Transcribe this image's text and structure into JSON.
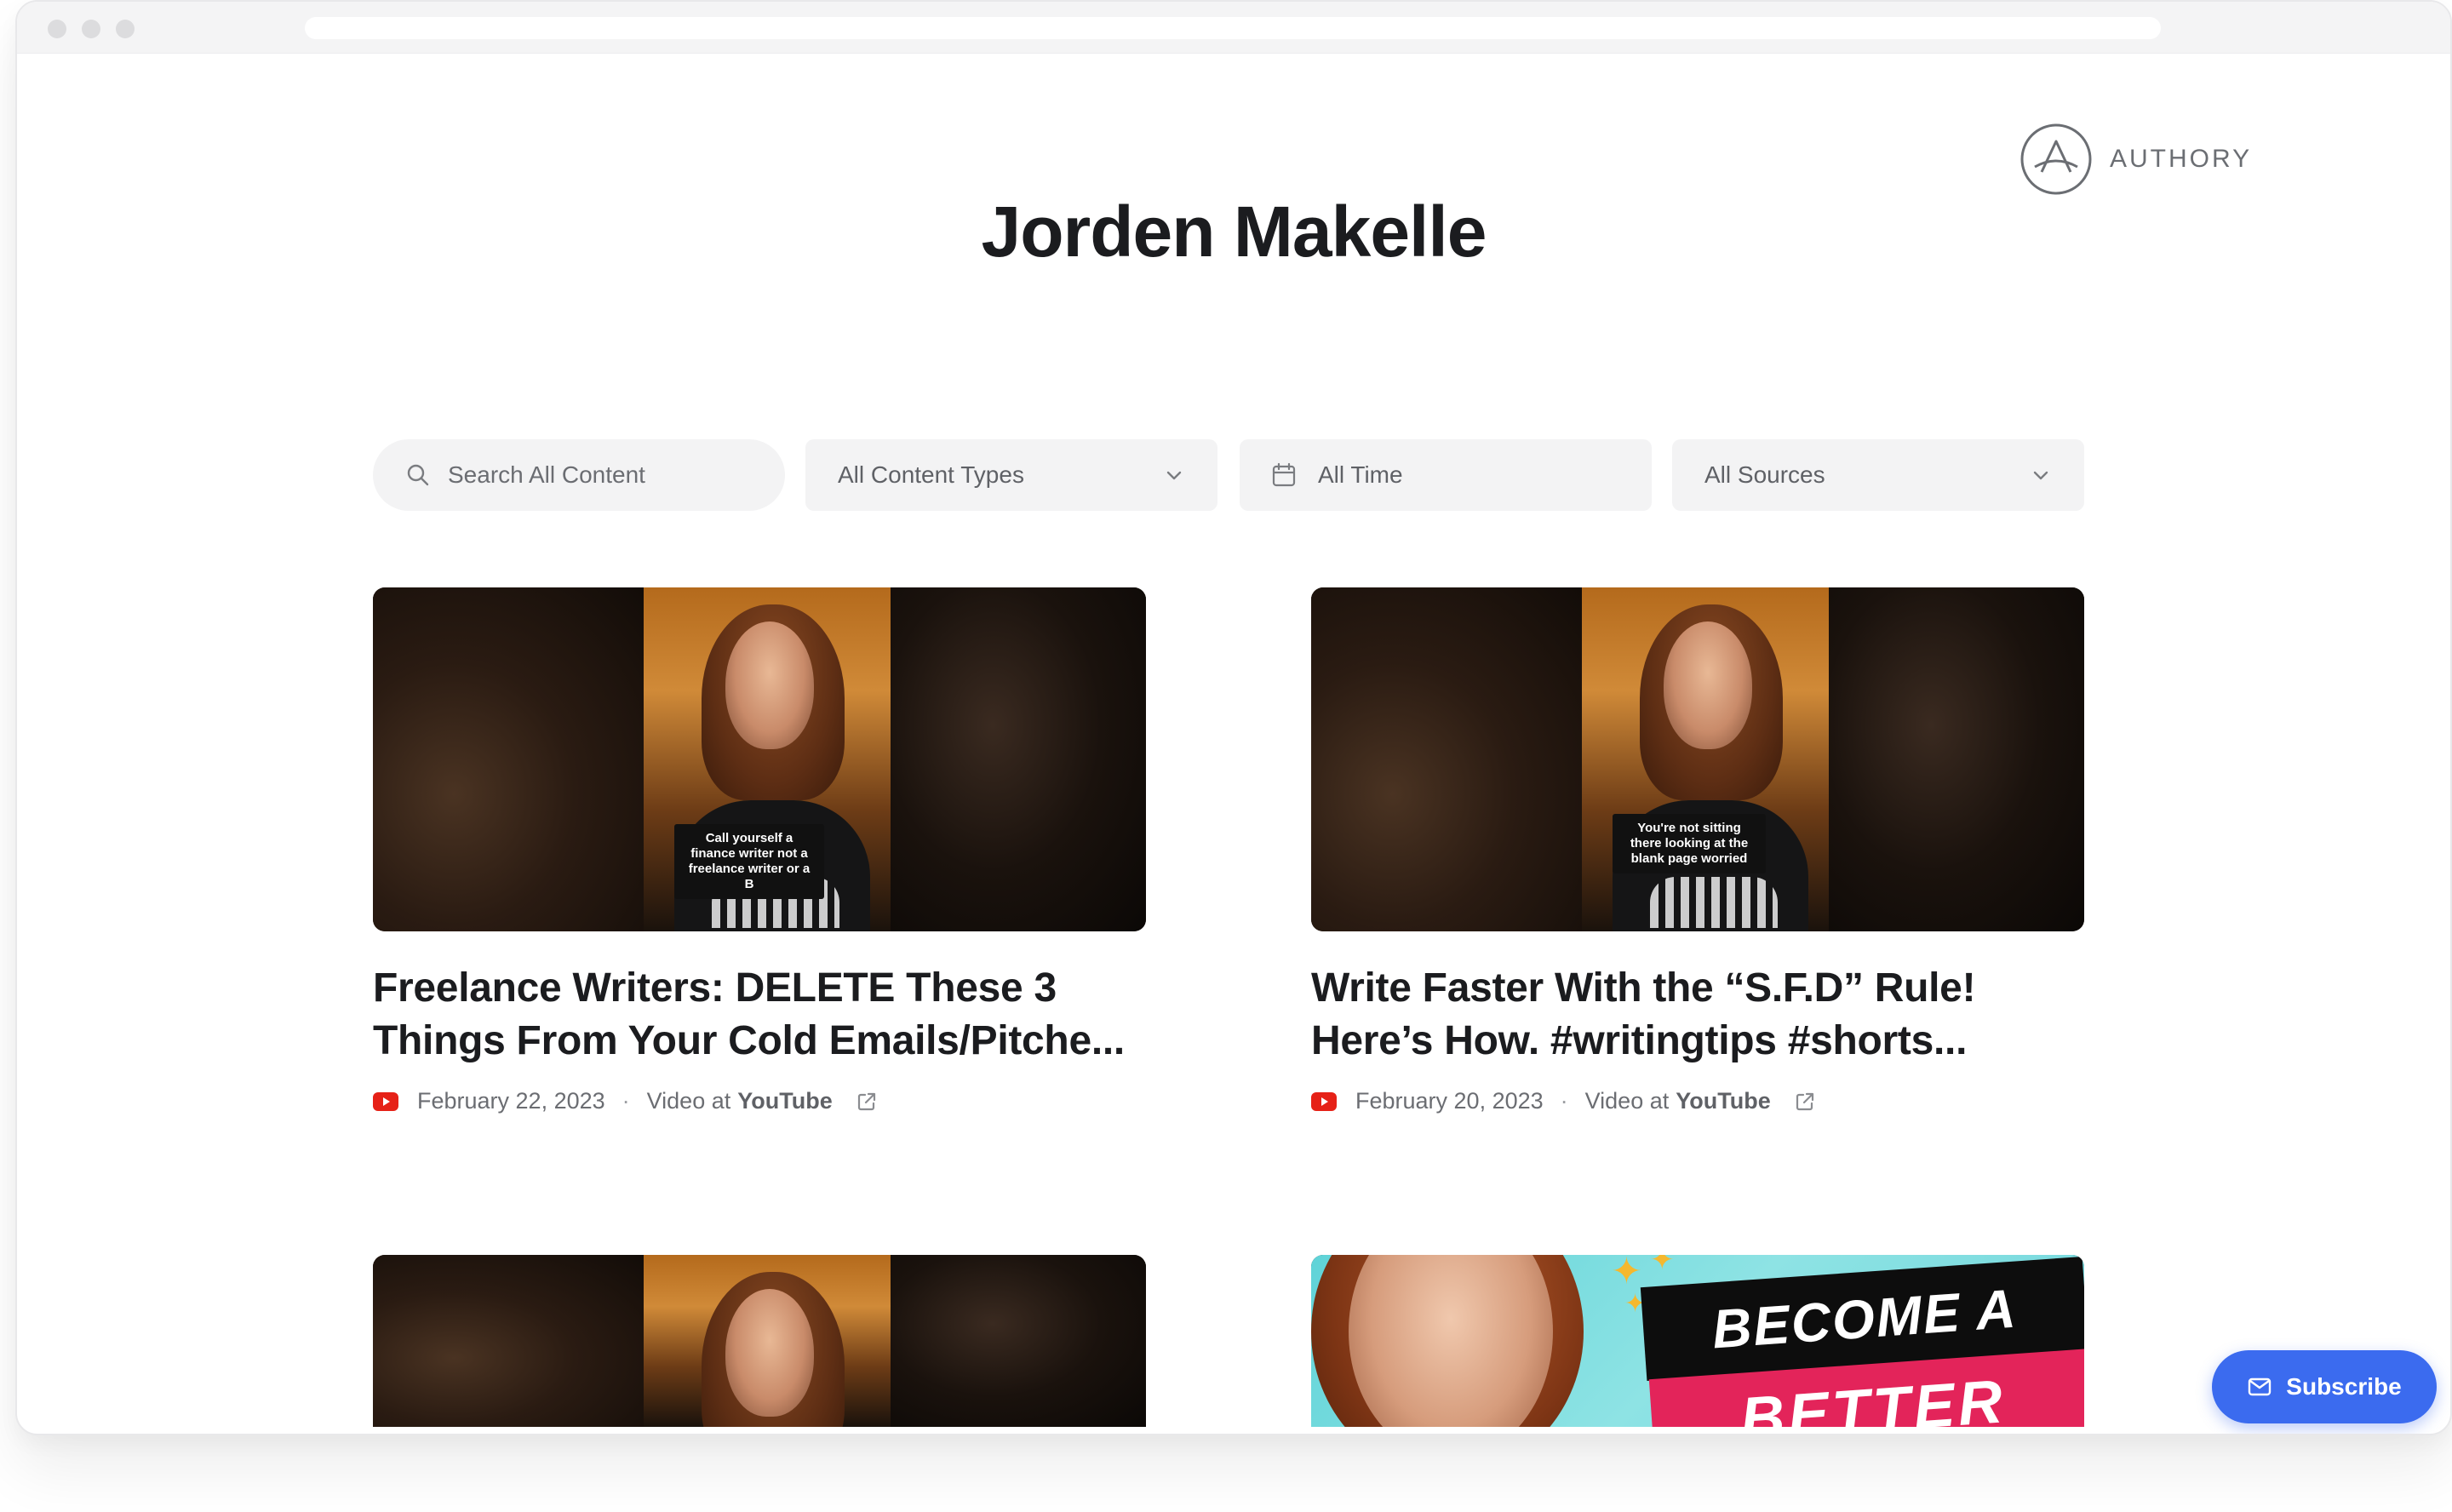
{
  "brand": {
    "name": "AUTHORY",
    "logo_icon": "authory-a-circle-icon"
  },
  "page": {
    "title": "Jorden Makelle"
  },
  "filters": {
    "search_placeholder": "Search All Content",
    "content_types": "All Content Types",
    "time": "All Time",
    "sources": "All Sources"
  },
  "cards": [
    {
      "title": "Freelance Writers: DELETE These 3 Things From Your Cold Emails/Pitche...",
      "date": "February 22, 2023",
      "type_prefix": "Video at",
      "source": "YouTube",
      "caption": "Call yourself a finance writer not a freelance writer or a B"
    },
    {
      "title": "Write Faster With the “S.F.D” Rule! Here’s How. #writingtips #shorts...",
      "date": "February 20, 2023",
      "type_prefix": "Video at",
      "source": "YouTube",
      "caption": "You're not sitting there looking at the blank page worried"
    },
    {
      "title": "",
      "date": "",
      "source": ""
    },
    {
      "banner_line1": "BECOME A",
      "banner_line2": "BETTER"
    }
  ],
  "subscribe": {
    "label": "Subscribe"
  },
  "colors": {
    "accent": "#3b6bef",
    "youtube": "#e62117",
    "title": "#1b1c1f",
    "muted": "#6b6d72"
  },
  "icons": [
    "search-icon",
    "chevron-down-icon",
    "calendar-icon",
    "youtube-icon",
    "external-link-icon",
    "mail-icon"
  ]
}
